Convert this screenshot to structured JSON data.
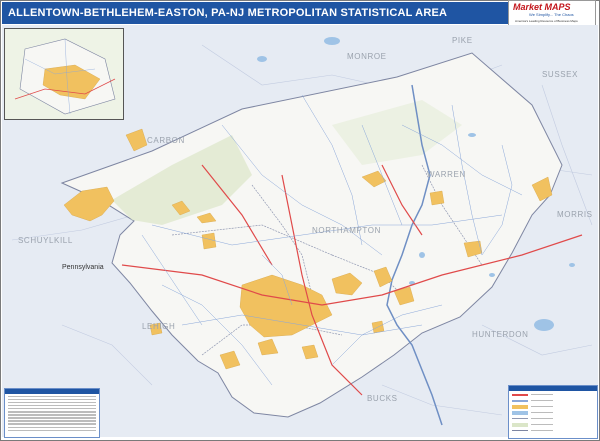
{
  "title": "ALLENTOWN-BETHLEHEM-EASTON, PA-NJ METROPOLITAN STATISTICAL AREA",
  "logo": {
    "brand": "Market MAPS",
    "tagline": "We Simplify... The Chaos",
    "subtitle": "America's Leading Resource of Business Maps"
  },
  "map": {
    "county_labels": [
      "PIKE",
      "MONROE",
      "SUSSEX",
      "CARBON",
      "WARREN",
      "MORRIS",
      "SCHUYLKILL",
      "NORTHAMPTON",
      "LEHIGH",
      "HUNTERDON",
      "BUCKS"
    ],
    "state_labels": [
      "Pennsylvania"
    ],
    "colors": {
      "background": "#e6ebf3",
      "msa_fill": "#f7f7f4",
      "urban": "#f1c15f",
      "water": "#9fc3e6",
      "forest": "#dbe6c8",
      "highway": "#e04a4a",
      "road": "#8aa7d9",
      "title_bar": "#1f55a3"
    }
  }
}
